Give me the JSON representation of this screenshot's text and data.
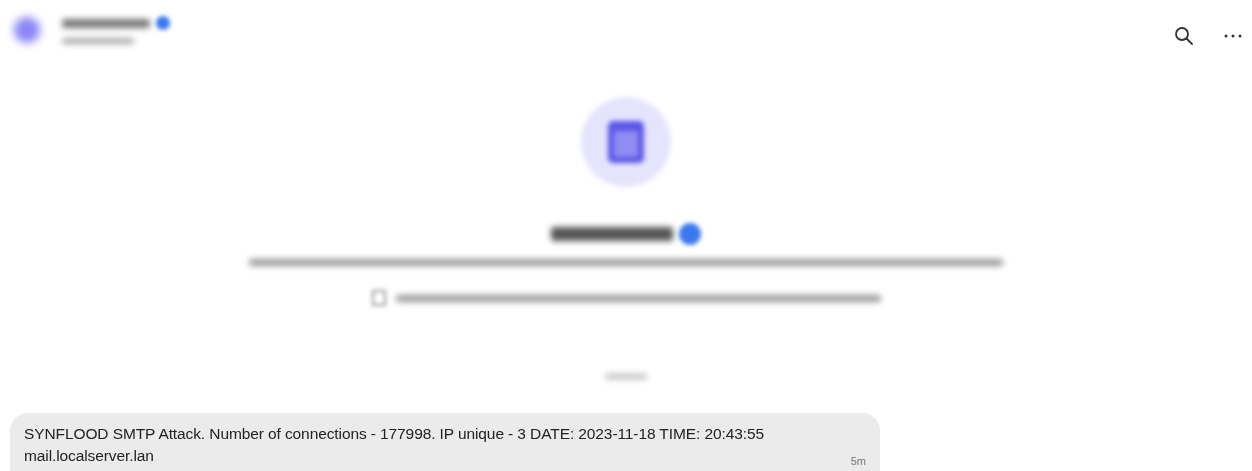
{
  "header": {
    "actions": [
      {
        "kind": "search"
      },
      {
        "kind": "more"
      }
    ]
  },
  "message": {
    "text": "SYNFLOOD SMTP Attack. Number of connections - 177998. IP unique - 3 DATE: 2023-11-18 TIME: 20:43:55\nmail.localserver.lan",
    "time": "5m"
  }
}
